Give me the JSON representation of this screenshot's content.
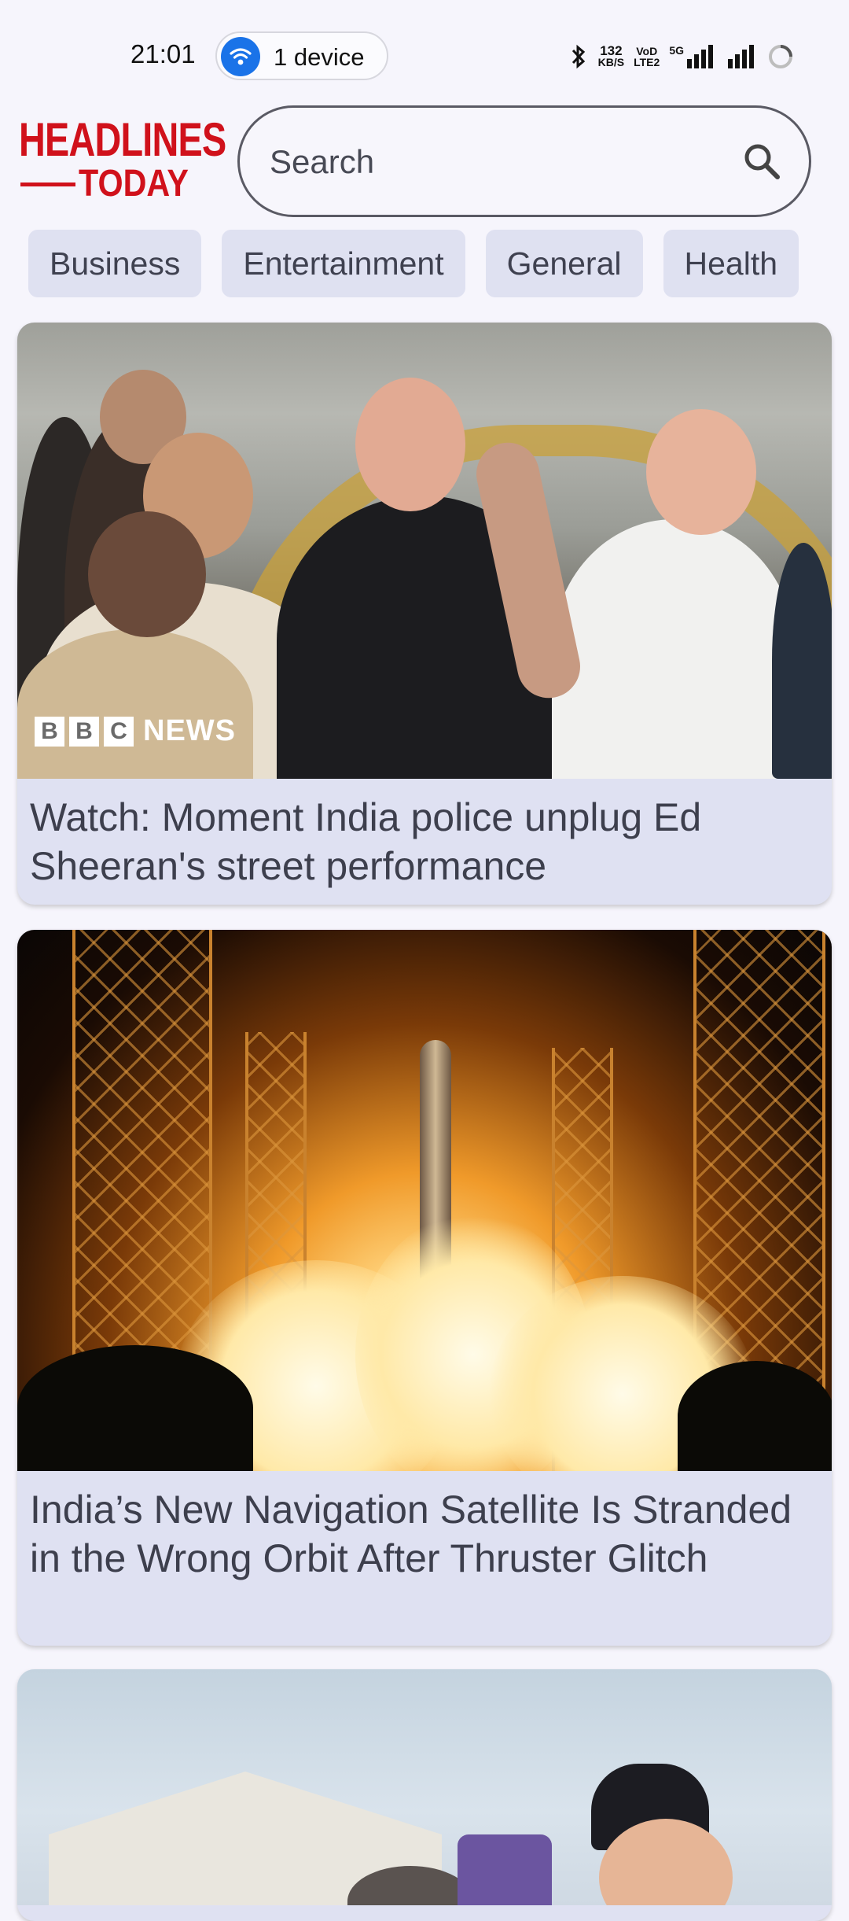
{
  "status_bar": {
    "time": "21:01",
    "device_pill": "1 device",
    "data_speed_top": "132",
    "data_speed_unit": "KB/S",
    "volte_top": "VoD",
    "volte_bottom": "LTE2",
    "network": "5G"
  },
  "header": {
    "logo_line1": "HEADLINES",
    "logo_line2": "TODAY",
    "search_placeholder": "Search"
  },
  "categories": [
    "Business",
    "Entertainment",
    "General",
    "Health"
  ],
  "articles": [
    {
      "source_badge_letters": [
        "B",
        "B",
        "C"
      ],
      "source_badge_word": "NEWS",
      "headline": "Watch: Moment India police unplug Ed Sheeran's street performance"
    },
    {
      "headline": "India’s New Navigation Satellite Is Stranded in the Wrong Orbit After Thruster Glitch"
    },
    {
      "headline": ""
    }
  ],
  "colors": {
    "brand_red": "#d0111b",
    "chip_bg": "#dfe1f1",
    "card_bg": "#dfe1f2",
    "wifi_blue": "#1a73e8"
  }
}
